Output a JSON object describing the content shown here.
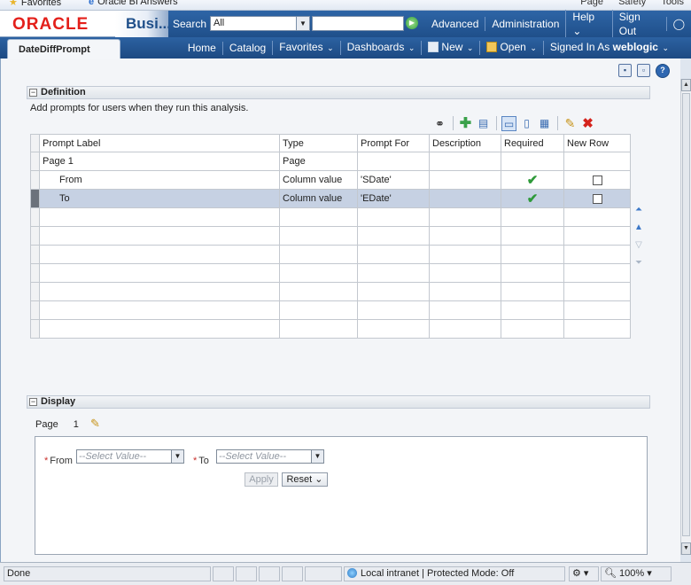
{
  "browser": {
    "favorites_label": "Favorites",
    "tab_title": "Oracle BI Answers",
    "toolbar_items": [
      "Page",
      "Safety",
      "Tools"
    ]
  },
  "header": {
    "logo": "ORACLE",
    "app_title": "Busi...",
    "search_label": "Search",
    "search_scope": "All",
    "links": [
      "Advanced",
      "Administration",
      "Help",
      "Sign Out"
    ]
  },
  "nav": {
    "document_tab": "DateDiffPrompt",
    "links": {
      "home": "Home",
      "catalog": "Catalog",
      "favorites": "Favorites",
      "dashboards": "Dashboards",
      "new": "New",
      "open": "Open",
      "signed_in_as": "Signed In As",
      "user": "weblogic"
    }
  },
  "definition": {
    "title": "Definition",
    "description": "Add prompts for users when they run this analysis.",
    "columns": [
      "Prompt Label",
      "Type",
      "Prompt For",
      "Description",
      "Required",
      "New Row"
    ],
    "rows": [
      {
        "label": "Page 1",
        "type": "Page",
        "prompt_for": "",
        "description": "",
        "required": false,
        "new_row": null,
        "selected": false
      },
      {
        "label": "From",
        "type": "Column value",
        "prompt_for": "'SDate'",
        "description": "",
        "required": true,
        "new_row": false,
        "selected": false
      },
      {
        "label": "To",
        "type": "Column value",
        "prompt_for": "'EDate'",
        "description": "",
        "required": true,
        "new_row": false,
        "selected": true
      }
    ],
    "empty_rows": 7
  },
  "display": {
    "title": "Display",
    "page_label": "Page",
    "page_number": "1",
    "from_label": "From",
    "to_label": "To",
    "select_placeholder": "--Select Value--",
    "apply_label": "Apply",
    "reset_label": "Reset"
  },
  "status": {
    "left": "Done",
    "zone": "Local intranet | Protected Mode: Off",
    "zoom": "100%"
  },
  "colors": {
    "oracle_red": "#e3201b",
    "header_blue": "#1f4f8a",
    "selected_row": "#c6d1e3",
    "check_green": "#2e9a3a"
  }
}
